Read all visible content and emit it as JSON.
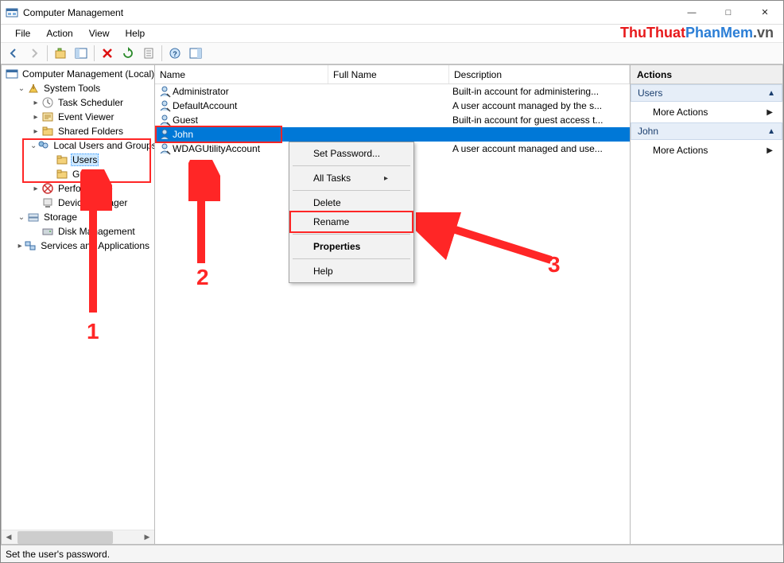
{
  "window": {
    "title": "Computer Management"
  },
  "menus": [
    "File",
    "Action",
    "View",
    "Help"
  ],
  "watermark": {
    "a": "ThuThuat",
    "b": "PhanMem",
    "c": ".vn"
  },
  "tree": {
    "root": "Computer Management (Local)",
    "system_tools": "System Tools",
    "task_scheduler": "Task Scheduler",
    "event_viewer": "Event Viewer",
    "shared_folders": "Shared Folders",
    "local_users": "Local Users and Groups",
    "users": "Users",
    "groups": "Groups",
    "performance": "Performance",
    "device_manager": "Device Manager",
    "storage": "Storage",
    "disk_management": "Disk Management",
    "services_apps": "Services and Applications"
  },
  "list": {
    "headers": {
      "name": "Name",
      "full": "Full Name",
      "desc": "Description"
    },
    "rows": [
      {
        "name": "Administrator",
        "full": "",
        "desc": "Built-in account for administering..."
      },
      {
        "name": "DefaultAccount",
        "full": "",
        "desc": "A user account managed by the s..."
      },
      {
        "name": "Guest",
        "full": "",
        "desc": "Built-in account for guest access t..."
      },
      {
        "name": "John",
        "full": "",
        "desc": ""
      },
      {
        "name": "WDAGUtilityAccount",
        "full": "",
        "desc": "A user account managed and use..."
      }
    ]
  },
  "context_menu": {
    "set_password": "Set Password...",
    "all_tasks": "All Tasks",
    "delete": "Delete",
    "rename": "Rename",
    "properties": "Properties",
    "help": "Help"
  },
  "actions": {
    "header": "Actions",
    "section1": "Users",
    "more1": "More Actions",
    "section2": "John",
    "more2": "More Actions"
  },
  "annotations": {
    "n1": "1",
    "n2": "2",
    "n3": "3"
  },
  "status": "Set the user's password."
}
